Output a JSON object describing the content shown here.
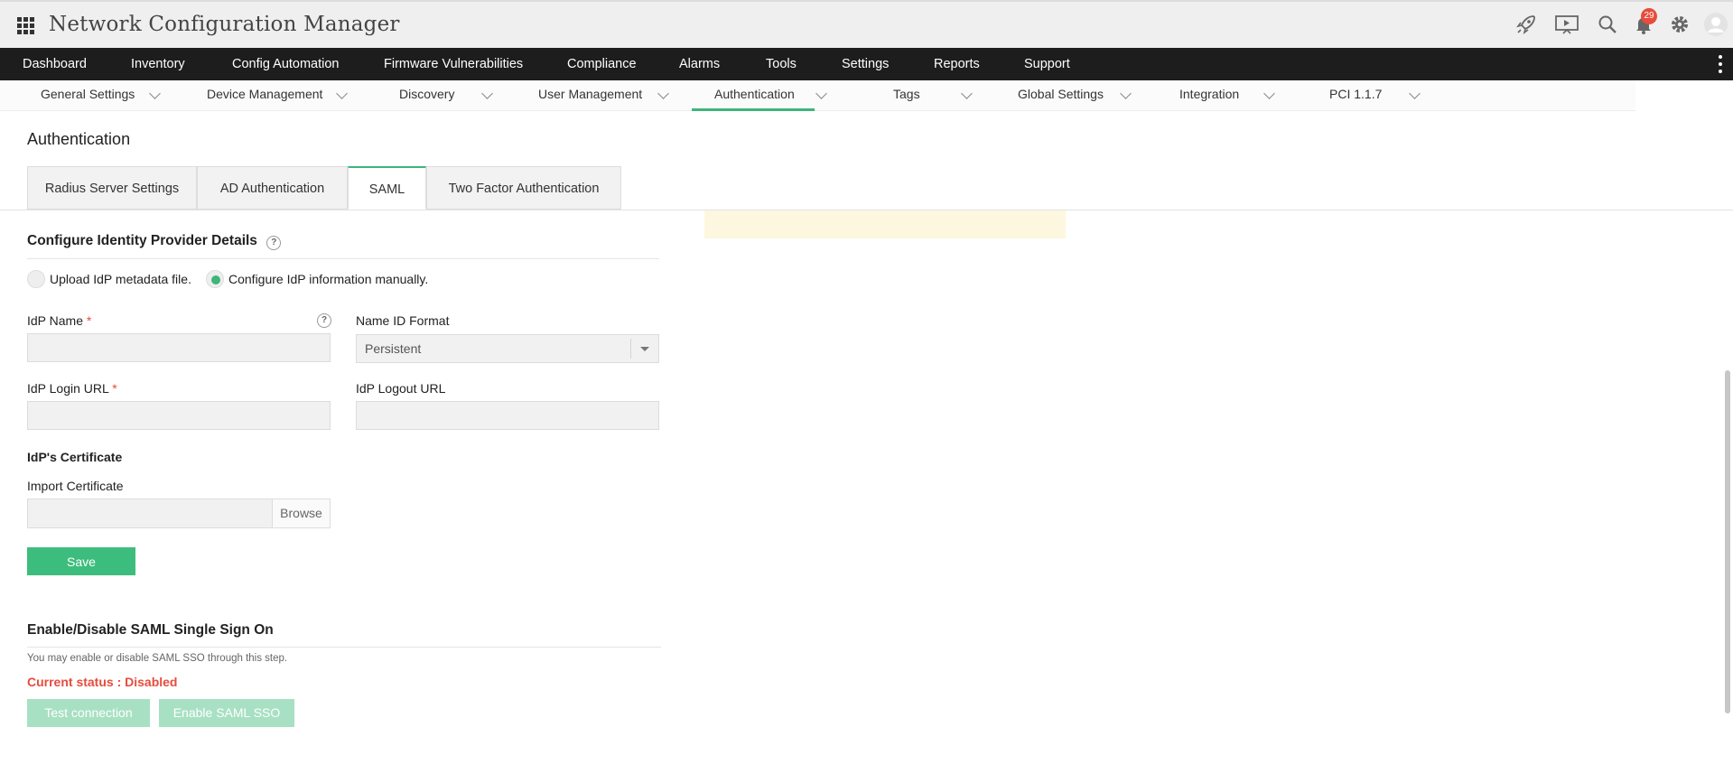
{
  "app": {
    "title": "Network Configuration Manager",
    "notification_count": "29"
  },
  "top_icons": [
    "rocket-icon",
    "presentation-icon",
    "search-icon",
    "bell-icon",
    "gear-icon",
    "user-avatar-icon"
  ],
  "main_nav": [
    "Dashboard",
    "Inventory",
    "Config Automation",
    "Firmware Vulnerabilities",
    "Compliance",
    "Alarms",
    "Tools",
    "Settings",
    "Reports",
    "Support"
  ],
  "sub_nav": [
    "General Settings",
    "Device Management",
    "Discovery",
    "User Management",
    "Authentication",
    "Tags",
    "Global Settings",
    "Integration",
    "PCI 1.1.7"
  ],
  "page": {
    "title": "Authentication"
  },
  "tabs": [
    "Radius Server Settings",
    "AD Authentication",
    "SAML",
    "Two Factor Authentication"
  ],
  "idp": {
    "section_title": "Configure Identity Provider Details",
    "help": "?",
    "radio_upload": "Upload IdP metadata file.",
    "radio_manual": "Configure IdP information manually.",
    "idp_name_label": "IdP Name",
    "required_mark": "*",
    "name_id_label": "Name ID Format",
    "name_id_value": "Persistent",
    "login_url_label": "IdP Login URL",
    "logout_url_label": "IdP Logout URL",
    "cert_heading": "IdP's Certificate",
    "import_label": "Import Certificate",
    "browse": "Browse",
    "save": "Save"
  },
  "sso": {
    "title": "Enable/Disable SAML Single Sign On",
    "note": "You may enable or disable SAML SSO through this step.",
    "status": "Current status : Disabled",
    "test_button": "Test connection",
    "enable_button": "Enable SAML SSO"
  },
  "colors": {
    "accent": "#3db57b",
    "error": "#e74c3c",
    "nav_bg": "#1d1d1d"
  }
}
